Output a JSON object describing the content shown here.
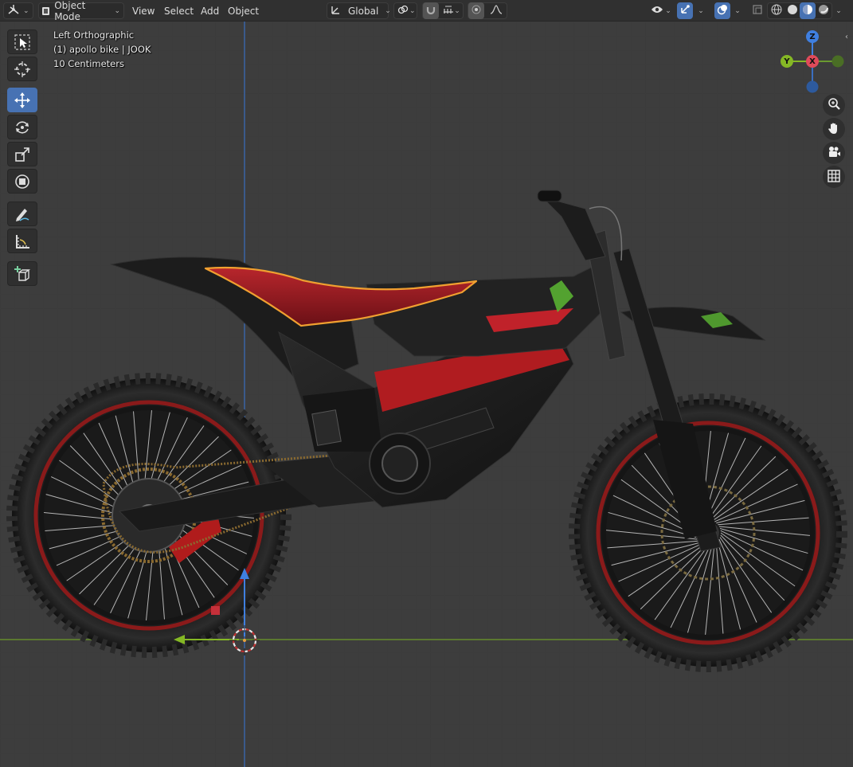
{
  "header": {
    "mode_label": "Object Mode",
    "menus": [
      "View",
      "Select",
      "Add",
      "Object"
    ],
    "transform_orientation": "Global"
  },
  "viewport": {
    "view_name": "Left Orthographic",
    "object_info": "(1) apollo bike | JOOK",
    "grid_scale": "10 Centimeters"
  },
  "gizmo": {
    "z_label": "Z",
    "y_label": "Y",
    "x_label": "X"
  },
  "colors": {
    "accent": "#4772b3",
    "axis_x": "#e04a5a",
    "axis_y": "#85b825",
    "axis_z": "#3f7fe0",
    "selection_outline": "#f0a030"
  }
}
